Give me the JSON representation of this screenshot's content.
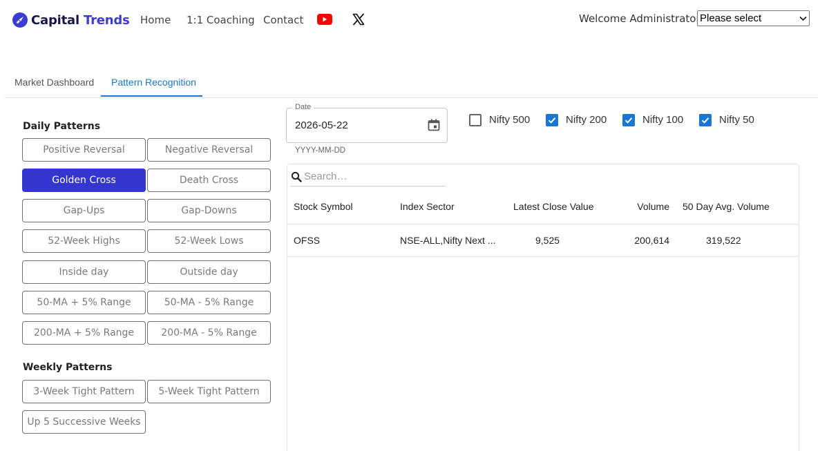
{
  "brand": {
    "name_part1": "Capital",
    "name_part2": "Trends"
  },
  "nav": {
    "home": "Home",
    "coaching": "1:1 Coaching",
    "contact": "Contact"
  },
  "icons": {
    "logo": "rocket-icon",
    "youtube": "youtube-icon",
    "x": "x-twitter-icon",
    "calendar": "calendar-icon",
    "search": "search-icon",
    "checkbox": "check-icon"
  },
  "colors": {
    "brand": "#3b3bd6",
    "selected_button": "#3535cf",
    "tab_accent": "#1976d2",
    "checkbox_on": "#1976d2",
    "youtube": "#ff0000"
  },
  "header": {
    "welcome": "Welcome Administrator",
    "select_value": "Please select"
  },
  "tabs": [
    {
      "label": "Market Dashboard",
      "active": false
    },
    {
      "label": "Pattern Recognition",
      "active": true
    }
  ],
  "daily": {
    "title": "Daily Patterns",
    "buttons": [
      "Positive Reversal",
      "Negative Reversal",
      "Golden Cross",
      "Death Cross",
      "Gap-Ups",
      "Gap-Downs",
      "52-Week Highs",
      "52-Week Lows",
      "Inside day",
      "Outside day",
      "50-MA + 5% Range",
      "50-MA - 5% Range",
      "200-MA + 5% Range",
      "200-MA - 5% Range"
    ],
    "selected": "Golden Cross"
  },
  "weekly": {
    "title": "Weekly Patterns",
    "buttons": [
      "3-Week Tight Pattern",
      "5-Week Tight Pattern",
      "Up 5 Successive Weeks"
    ]
  },
  "date": {
    "label": "Date",
    "value": "2026-05-22",
    "helper": "YYYY-MM-DD"
  },
  "indices": [
    {
      "label": "Nifty 500",
      "checked": false
    },
    {
      "label": "Nifty 200",
      "checked": true
    },
    {
      "label": "Nifty 100",
      "checked": true
    },
    {
      "label": "Nifty 50",
      "checked": true
    }
  ],
  "search": {
    "placeholder": "Search…",
    "value": ""
  },
  "table": {
    "columns": [
      "Stock Symbol",
      "Index Sector",
      "Latest Close Value",
      "Volume",
      "50 Day Avg. Volume"
    ],
    "rows": [
      [
        "OFSS",
        "NSE-ALL,Nifty Next ...",
        "9,525",
        "200,614",
        "319,522"
      ]
    ]
  }
}
